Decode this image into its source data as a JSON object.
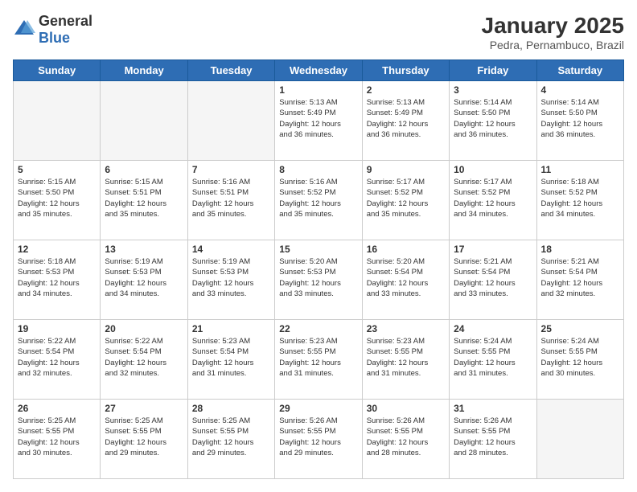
{
  "header": {
    "logo_general": "General",
    "logo_blue": "Blue",
    "month_year": "January 2025",
    "location": "Pedra, Pernambuco, Brazil"
  },
  "days_of_week": [
    "Sunday",
    "Monday",
    "Tuesday",
    "Wednesday",
    "Thursday",
    "Friday",
    "Saturday"
  ],
  "weeks": [
    [
      {
        "day": "",
        "info": ""
      },
      {
        "day": "",
        "info": ""
      },
      {
        "day": "",
        "info": ""
      },
      {
        "day": "1",
        "info": "Sunrise: 5:13 AM\nSunset: 5:49 PM\nDaylight: 12 hours\nand 36 minutes."
      },
      {
        "day": "2",
        "info": "Sunrise: 5:13 AM\nSunset: 5:49 PM\nDaylight: 12 hours\nand 36 minutes."
      },
      {
        "day": "3",
        "info": "Sunrise: 5:14 AM\nSunset: 5:50 PM\nDaylight: 12 hours\nand 36 minutes."
      },
      {
        "day": "4",
        "info": "Sunrise: 5:14 AM\nSunset: 5:50 PM\nDaylight: 12 hours\nand 36 minutes."
      }
    ],
    [
      {
        "day": "5",
        "info": "Sunrise: 5:15 AM\nSunset: 5:50 PM\nDaylight: 12 hours\nand 35 minutes."
      },
      {
        "day": "6",
        "info": "Sunrise: 5:15 AM\nSunset: 5:51 PM\nDaylight: 12 hours\nand 35 minutes."
      },
      {
        "day": "7",
        "info": "Sunrise: 5:16 AM\nSunset: 5:51 PM\nDaylight: 12 hours\nand 35 minutes."
      },
      {
        "day": "8",
        "info": "Sunrise: 5:16 AM\nSunset: 5:52 PM\nDaylight: 12 hours\nand 35 minutes."
      },
      {
        "day": "9",
        "info": "Sunrise: 5:17 AM\nSunset: 5:52 PM\nDaylight: 12 hours\nand 35 minutes."
      },
      {
        "day": "10",
        "info": "Sunrise: 5:17 AM\nSunset: 5:52 PM\nDaylight: 12 hours\nand 34 minutes."
      },
      {
        "day": "11",
        "info": "Sunrise: 5:18 AM\nSunset: 5:52 PM\nDaylight: 12 hours\nand 34 minutes."
      }
    ],
    [
      {
        "day": "12",
        "info": "Sunrise: 5:18 AM\nSunset: 5:53 PM\nDaylight: 12 hours\nand 34 minutes."
      },
      {
        "day": "13",
        "info": "Sunrise: 5:19 AM\nSunset: 5:53 PM\nDaylight: 12 hours\nand 34 minutes."
      },
      {
        "day": "14",
        "info": "Sunrise: 5:19 AM\nSunset: 5:53 PM\nDaylight: 12 hours\nand 33 minutes."
      },
      {
        "day": "15",
        "info": "Sunrise: 5:20 AM\nSunset: 5:53 PM\nDaylight: 12 hours\nand 33 minutes."
      },
      {
        "day": "16",
        "info": "Sunrise: 5:20 AM\nSunset: 5:54 PM\nDaylight: 12 hours\nand 33 minutes."
      },
      {
        "day": "17",
        "info": "Sunrise: 5:21 AM\nSunset: 5:54 PM\nDaylight: 12 hours\nand 33 minutes."
      },
      {
        "day": "18",
        "info": "Sunrise: 5:21 AM\nSunset: 5:54 PM\nDaylight: 12 hours\nand 32 minutes."
      }
    ],
    [
      {
        "day": "19",
        "info": "Sunrise: 5:22 AM\nSunset: 5:54 PM\nDaylight: 12 hours\nand 32 minutes."
      },
      {
        "day": "20",
        "info": "Sunrise: 5:22 AM\nSunset: 5:54 PM\nDaylight: 12 hours\nand 32 minutes."
      },
      {
        "day": "21",
        "info": "Sunrise: 5:23 AM\nSunset: 5:54 PM\nDaylight: 12 hours\nand 31 minutes."
      },
      {
        "day": "22",
        "info": "Sunrise: 5:23 AM\nSunset: 5:55 PM\nDaylight: 12 hours\nand 31 minutes."
      },
      {
        "day": "23",
        "info": "Sunrise: 5:23 AM\nSunset: 5:55 PM\nDaylight: 12 hours\nand 31 minutes."
      },
      {
        "day": "24",
        "info": "Sunrise: 5:24 AM\nSunset: 5:55 PM\nDaylight: 12 hours\nand 31 minutes."
      },
      {
        "day": "25",
        "info": "Sunrise: 5:24 AM\nSunset: 5:55 PM\nDaylight: 12 hours\nand 30 minutes."
      }
    ],
    [
      {
        "day": "26",
        "info": "Sunrise: 5:25 AM\nSunset: 5:55 PM\nDaylight: 12 hours\nand 30 minutes."
      },
      {
        "day": "27",
        "info": "Sunrise: 5:25 AM\nSunset: 5:55 PM\nDaylight: 12 hours\nand 29 minutes."
      },
      {
        "day": "28",
        "info": "Sunrise: 5:25 AM\nSunset: 5:55 PM\nDaylight: 12 hours\nand 29 minutes."
      },
      {
        "day": "29",
        "info": "Sunrise: 5:26 AM\nSunset: 5:55 PM\nDaylight: 12 hours\nand 29 minutes."
      },
      {
        "day": "30",
        "info": "Sunrise: 5:26 AM\nSunset: 5:55 PM\nDaylight: 12 hours\nand 28 minutes."
      },
      {
        "day": "31",
        "info": "Sunrise: 5:26 AM\nSunset: 5:55 PM\nDaylight: 12 hours\nand 28 minutes."
      },
      {
        "day": "",
        "info": ""
      }
    ]
  ]
}
